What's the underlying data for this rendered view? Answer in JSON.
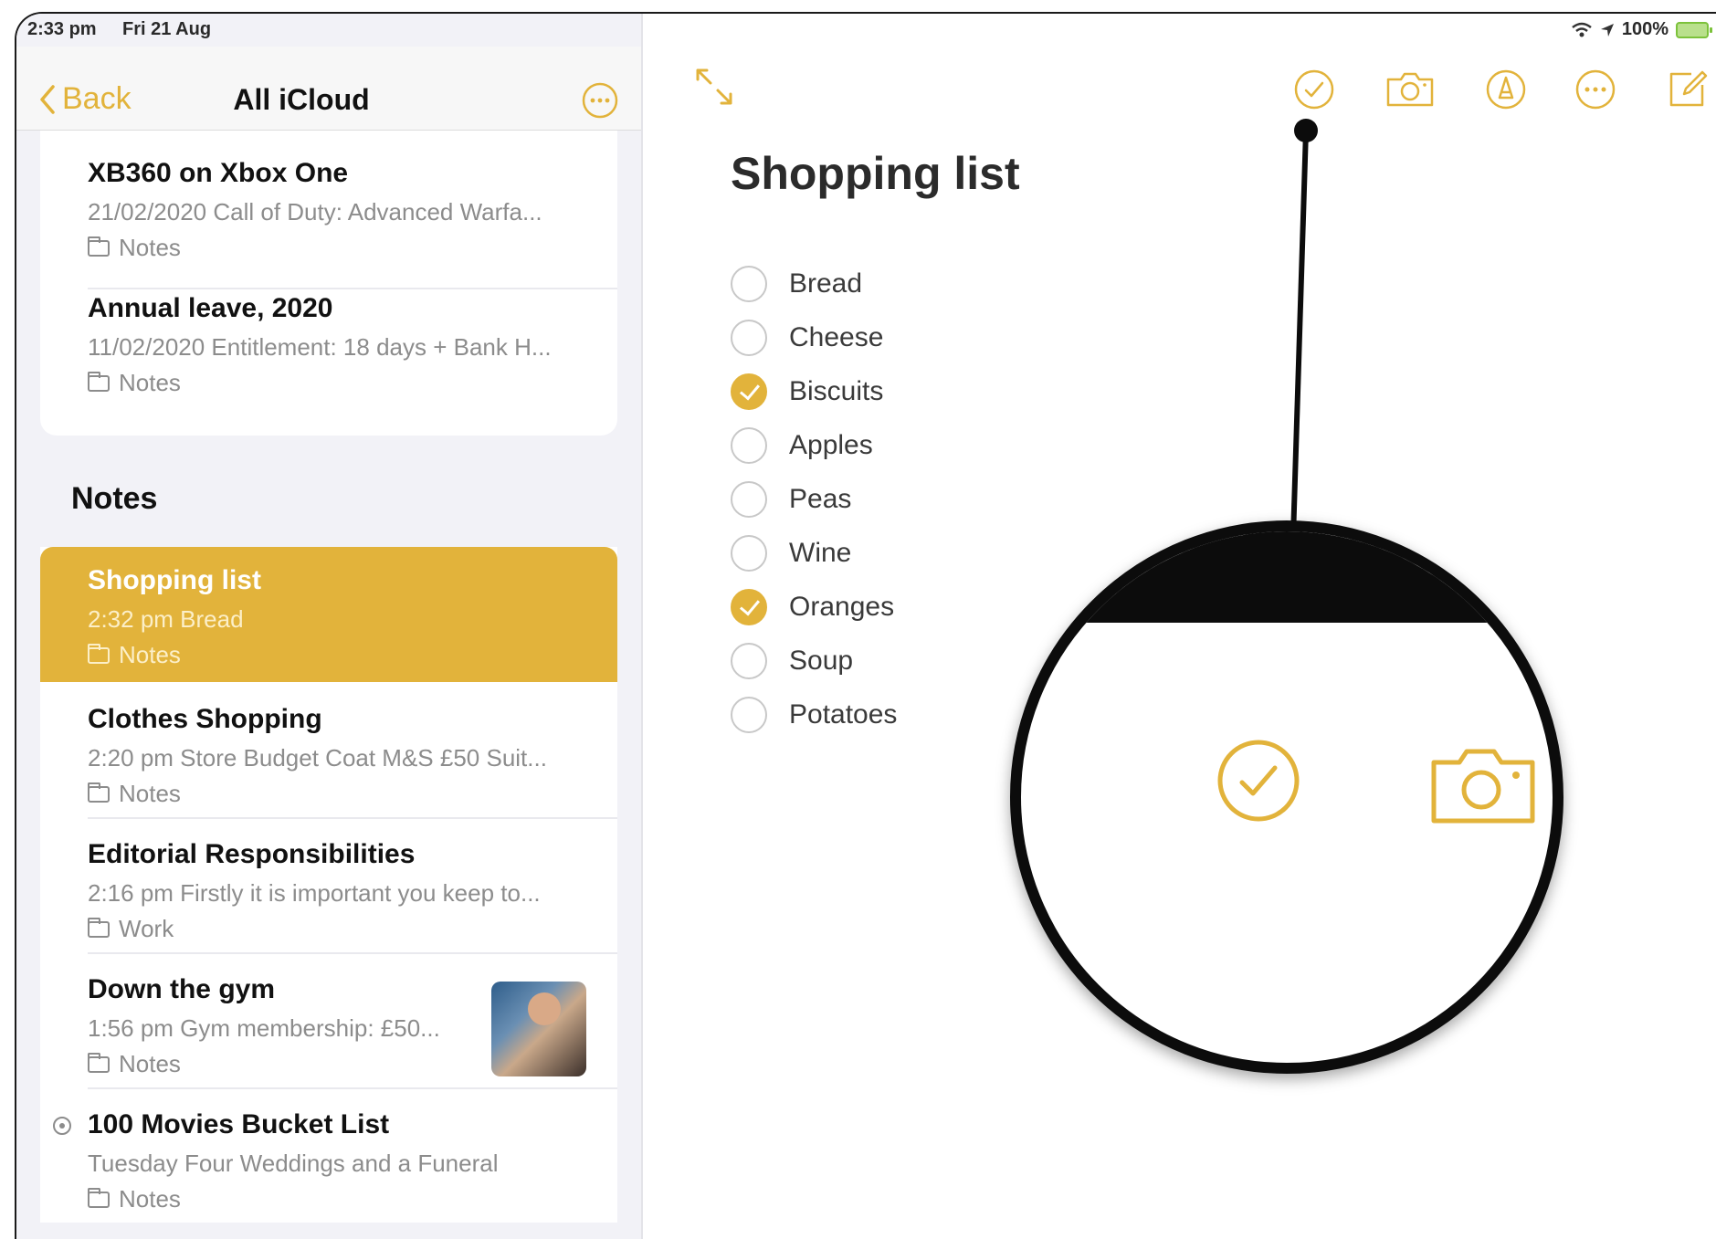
{
  "status_bar": {
    "time": "2:33 pm",
    "date": "Fri 21 Aug",
    "battery": "100%"
  },
  "sidebar": {
    "back_label": "Back",
    "title": "All iCloud",
    "section_title": "Notes",
    "top_notes": [
      {
        "title": "XB360 on Xbox One",
        "subtitle": "21/02/2020  Call of Duty: Advanced Warfa...",
        "folder": "Notes"
      },
      {
        "title": "Annual leave, 2020",
        "subtitle": "11/02/2020  Entitlement: 18 days + Bank H...",
        "folder": "Notes"
      }
    ],
    "notes": [
      {
        "title": "Shopping list",
        "subtitle": "2:32 pm  Bread",
        "folder": "Notes"
      },
      {
        "title": "Clothes Shopping",
        "subtitle": "2:20 pm  Store Budget Coat M&S £50 Suit...",
        "folder": "Notes"
      },
      {
        "title": "Editorial Responsibilities",
        "subtitle": "2:16 pm  Firstly it is important you keep to...",
        "folder": "Work"
      },
      {
        "title": "Down the gym",
        "subtitle": "1:56 pm  Gym membership: £50...",
        "folder": "Notes"
      },
      {
        "title": "100 Movies Bucket List",
        "subtitle": "Tuesday  Four Weddings and a Funeral",
        "folder": "Notes"
      }
    ]
  },
  "editor": {
    "title": "Shopping list",
    "checklist": [
      {
        "label": "Bread",
        "checked": false
      },
      {
        "label": "Cheese",
        "checked": false
      },
      {
        "label": "Biscuits",
        "checked": true
      },
      {
        "label": "Apples",
        "checked": false
      },
      {
        "label": "Peas",
        "checked": false
      },
      {
        "label": "Wine",
        "checked": false
      },
      {
        "label": "Oranges",
        "checked": true
      },
      {
        "label": "Soup",
        "checked": false
      },
      {
        "label": "Potatoes",
        "checked": false
      }
    ],
    "toolbar_icons": [
      "expand-icon",
      "checklist-icon",
      "camera-icon",
      "markup-icon",
      "more-icon",
      "compose-icon"
    ]
  },
  "colors": {
    "accent": "#e2b33b",
    "check_fill": "#f2b32b",
    "callout": "#0c0c0c"
  }
}
